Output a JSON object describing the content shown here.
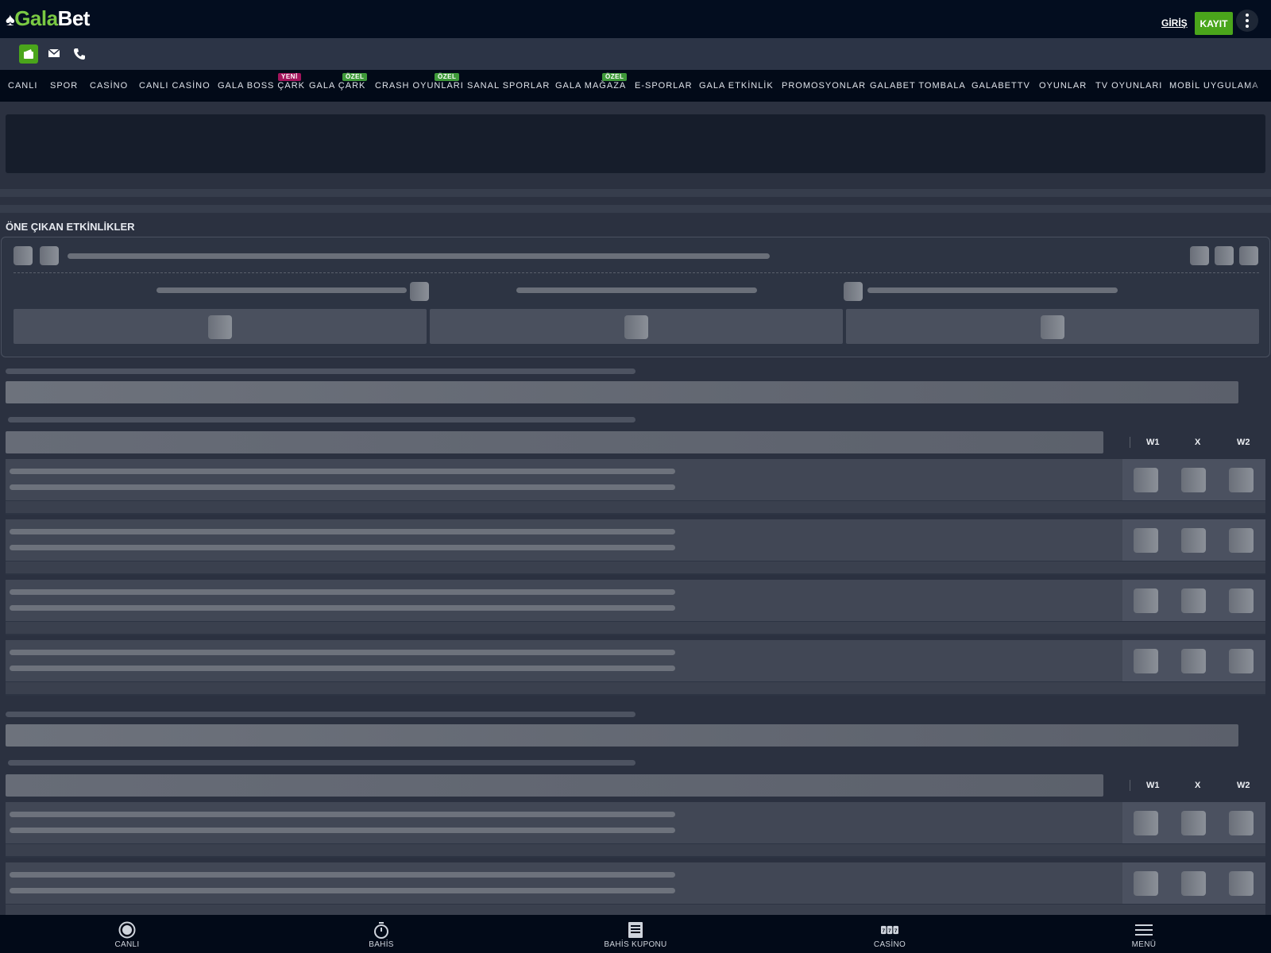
{
  "header": {
    "logo_part1": "Gala",
    "logo_part2": "Bet",
    "login_label": "GİRİŞ",
    "register_label": "KAYIT"
  },
  "nav": {
    "items": [
      {
        "label": "CANLI"
      },
      {
        "label": "SPOR"
      },
      {
        "label": "CASİNO"
      },
      {
        "label": "CANLI CASİNO"
      },
      {
        "label": "GALA BOSS ÇARK",
        "badge": "YENİ"
      },
      {
        "label": "GALA ÇARK",
        "badge": "ÖZEL"
      },
      {
        "label": "CRASH OYUNLARI",
        "badge": "ÖZEL"
      },
      {
        "label": "SANAL SPORLAR"
      },
      {
        "label": "GALA MAĞAZA",
        "badge": "ÖZEL"
      },
      {
        "label": "E-SPORLAR"
      },
      {
        "label": "GALA ETKİNLİK"
      },
      {
        "label": "PROMOSYONLAR"
      },
      {
        "label": "GALABET TOMBALA"
      },
      {
        "label": "GALABETTV"
      },
      {
        "label": "OYUNLAR"
      },
      {
        "label": "TV OYUNLARI"
      },
      {
        "label": "MOBİL UYGULAMA"
      }
    ],
    "badge_colors": {
      "YENİ": "#a3145c",
      "ÖZEL": "#3f9a3a"
    }
  },
  "featured": {
    "title": "ÖNE ÇIKAN ETKİNLİKLER"
  },
  "markets": {
    "columns": [
      "W1",
      "X",
      "W2"
    ]
  },
  "tabbar": {
    "items": [
      {
        "label": "CANLI",
        "icon": "live-icon"
      },
      {
        "label": "BAHİS",
        "icon": "stopwatch-icon"
      },
      {
        "label": "BAHİS KUPONU",
        "icon": "betslip-icon"
      },
      {
        "label": "CASİNO",
        "icon": "slot-icon"
      },
      {
        "label": "MENÜ",
        "icon": "menu-icon"
      }
    ]
  },
  "colors": {
    "accent_green": "#4aa51b",
    "logo_green": "#7ac943",
    "header_bg": "#030d1f",
    "page_bg": "#2b3140"
  }
}
